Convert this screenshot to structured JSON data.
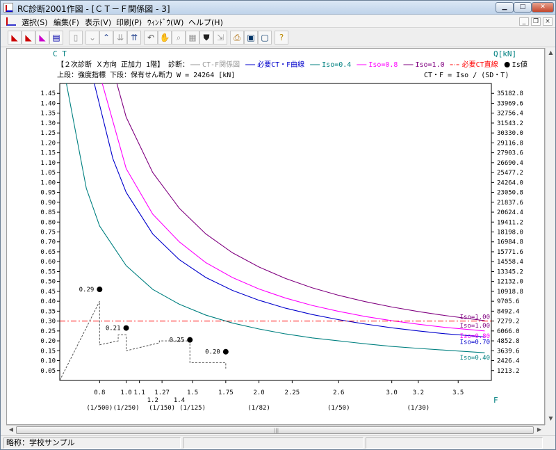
{
  "window": {
    "title": "RC診断2001作図 - [ＣＴ－Ｆ関係図 - 3]"
  },
  "menu": {
    "items": [
      {
        "label": "選択(S)"
      },
      {
        "label": "編集(F)"
      },
      {
        "label": "表示(V)"
      },
      {
        "label": "印刷(P)"
      },
      {
        "label": "ｳｨﾝﾄﾞｳ(W)"
      },
      {
        "label": "ヘルプ(H)"
      }
    ]
  },
  "toolbar": {
    "buttons": [
      {
        "icon": "chart-icon-1"
      },
      {
        "icon": "chart-icon-2"
      },
      {
        "icon": "chart-icon-3"
      },
      {
        "icon": "chart-icon-4"
      },
      {
        "icon": "page-icon"
      },
      {
        "icon": "chevron-down-icon"
      },
      {
        "icon": "chevron-up-icon"
      },
      {
        "icon": "double-chevron-down-icon"
      },
      {
        "icon": "double-chevron-up-icon"
      },
      {
        "icon": "undo-icon"
      },
      {
        "icon": "hand-icon"
      },
      {
        "icon": "zoom-icon"
      },
      {
        "icon": "grid-icon"
      },
      {
        "icon": "shield-icon"
      },
      {
        "icon": "export-icon"
      },
      {
        "icon": "printer-icon"
      },
      {
        "icon": "window-icon"
      },
      {
        "icon": "dialog-icon"
      },
      {
        "icon": "help-icon"
      }
    ]
  },
  "status": {
    "left": "略称：学校サンプル",
    "middle": "",
    "right": ""
  },
  "chart_data": {
    "type": "line",
    "header_line1": "【２次診断 Ｘ方向 正加力 1階】",
    "header_line2": "上段：強度指標 下段：保有せん断力  W = 24264 [kN]",
    "formula": "CT・F = Iso / (SD・T)",
    "left_axis_title": "C T",
    "right_axis_title": "Q[kN]",
    "x_axis_title": "F",
    "legend": {
      "prefix": "診断：",
      "items": [
        {
          "label": "CT-F関係図",
          "color": "#999999",
          "style": "line"
        },
        {
          "label": "必要CT・F曲線",
          "color": "#0000cc",
          "style": "line"
        },
        {
          "label": "Iso=0.4",
          "color": "#008080",
          "style": "line"
        },
        {
          "label": "Iso=0.8",
          "color": "#ff00ff",
          "style": "line"
        },
        {
          "label": "Iso=1.0",
          "color": "#800080",
          "style": "line"
        },
        {
          "label": "必要CT直線",
          "color": "#ff0000",
          "style": "dashdot"
        },
        {
          "label": "Is値",
          "color": "#000000",
          "style": "dot"
        }
      ]
    },
    "y_ticks": [
      "1.45",
      "1.40",
      "1.35",
      "1.30",
      "1.25",
      "1.20",
      "1.15",
      "1.10",
      "1.05",
      "1.00",
      "0.95",
      "0.90",
      "0.85",
      "0.80",
      "0.75",
      "0.70",
      "0.65",
      "0.60",
      "0.55",
      "0.50",
      "0.45",
      "0.40",
      "0.35",
      "0.30",
      "0.25",
      "0.20",
      "0.15",
      "0.10",
      "0.05"
    ],
    "q_ticks": [
      "35182.8",
      "33969.6",
      "32756.4",
      "31543.2",
      "30330.0",
      "29116.8",
      "27903.6",
      "26690.4",
      "25477.2",
      "24264.0",
      "23050.8",
      "21837.6",
      "20624.4",
      "19411.2",
      "18198.0",
      "16984.8",
      "15771.6",
      "14558.4",
      "13345.2",
      "12132.0",
      "10918.8",
      "9705.6",
      "8492.4",
      "7279.2",
      "6066.0",
      "4852.8",
      "3639.6",
      "2426.4",
      "1213.2"
    ],
    "y_min": 0.0,
    "y_max": 1.5,
    "x_tick_values": [
      0.8,
      1.0,
      1.1,
      1.27,
      1.5,
      1.75,
      2.0,
      2.25,
      2.6,
      3.0,
      3.2,
      3.5
    ],
    "x_tick_labels": [
      "0.8",
      "1.0",
      "1.1",
      "1.27",
      "1.5",
      "1.75",
      "2.0",
      "2.25",
      "2.6",
      "3.0",
      "3.2",
      "3.5"
    ],
    "x_sub_labels": [
      {
        "x": 1.2,
        "label": "1.2"
      },
      {
        "x": 1.4,
        "label": "1.4"
      }
    ],
    "drift_labels": [
      {
        "x": 0.8,
        "label": "(1/500)"
      },
      {
        "x": 1.0,
        "label": "(1/250)"
      },
      {
        "x": 1.27,
        "label": "(1/150)"
      },
      {
        "x": 1.5,
        "label": "(1/125)"
      },
      {
        "x": 2.0,
        "label": "(1/82)"
      },
      {
        "x": 2.6,
        "label": "(1/50)"
      },
      {
        "x": 3.2,
        "label": "(1/30)"
      }
    ],
    "series": [
      {
        "name": "Iso=0.40",
        "color": "#008080",
        "iso": 0.4,
        "curve_x": [
          0.55,
          0.7,
          0.8,
          1.0,
          1.2,
          1.4,
          1.6,
          1.8,
          2.0,
          2.2,
          2.4,
          2.6,
          2.8,
          3.0,
          3.2,
          3.4,
          3.7
        ],
        "curve_y": [
          1.5,
          0.97,
          0.78,
          0.58,
          0.46,
          0.385,
          0.33,
          0.29,
          0.26,
          0.235,
          0.215,
          0.2,
          0.185,
          0.172,
          0.162,
          0.153,
          0.14
        ]
      },
      {
        "name": "Iso=0.70",
        "color": "#0000cc",
        "iso": 0.7,
        "curve_x": [
          0.76,
          0.9,
          1.0,
          1.2,
          1.4,
          1.6,
          1.8,
          2.0,
          2.2,
          2.4,
          2.6,
          2.8,
          3.0,
          3.2,
          3.4,
          3.7
        ],
        "curve_y": [
          1.5,
          1.12,
          0.95,
          0.74,
          0.61,
          0.52,
          0.455,
          0.405,
          0.365,
          0.333,
          0.307,
          0.285,
          0.266,
          0.25,
          0.236,
          0.22
        ]
      },
      {
        "name": "Iso=0.80",
        "color": "#ff00ff",
        "iso": 0.8,
        "curve_x": [
          0.82,
          1.0,
          1.2,
          1.4,
          1.6,
          1.8,
          2.0,
          2.2,
          2.4,
          2.6,
          2.8,
          3.0,
          3.2,
          3.4,
          3.7
        ],
        "curve_y": [
          1.5,
          1.07,
          0.84,
          0.7,
          0.595,
          0.52,
          0.462,
          0.416,
          0.379,
          0.349,
          0.323,
          0.302,
          0.284,
          0.268,
          0.25
        ]
      },
      {
        "name": "Iso=1.00",
        "color": "#800080",
        "iso": 1.0,
        "curve_x": [
          0.93,
          1.0,
          1.2,
          1.4,
          1.6,
          1.8,
          2.0,
          2.2,
          2.4,
          2.6,
          2.8,
          3.0,
          3.2,
          3.4,
          3.7
        ],
        "curve_y": [
          1.5,
          1.33,
          1.05,
          0.87,
          0.74,
          0.645,
          0.573,
          0.515,
          0.468,
          0.43,
          0.398,
          0.371,
          0.348,
          0.328,
          0.302
        ]
      }
    ],
    "required_ct": 0.3,
    "required_ct_label": "Iso=1.00",
    "ct_f_path_x": [
      0.5,
      0.8,
      0.8,
      0.94,
      0.94,
      1.0,
      1.0,
      1.25,
      1.25,
      1.48,
      1.48,
      1.75,
      1.75
    ],
    "ct_f_path_y": [
      0.0,
      0.4,
      0.18,
      0.2,
      0.23,
      0.23,
      0.15,
      0.19,
      0.2,
      0.2,
      0.09,
      0.09,
      0.06
    ],
    "is_points": [
      {
        "x": 0.8,
        "y": 0.46,
        "label": "0.29"
      },
      {
        "x": 1.0,
        "y": 0.265,
        "label": "0.21"
      },
      {
        "x": 1.48,
        "y": 0.205,
        "label": "0.25"
      },
      {
        "x": 1.75,
        "y": 0.145,
        "label": "0.20"
      }
    ]
  }
}
